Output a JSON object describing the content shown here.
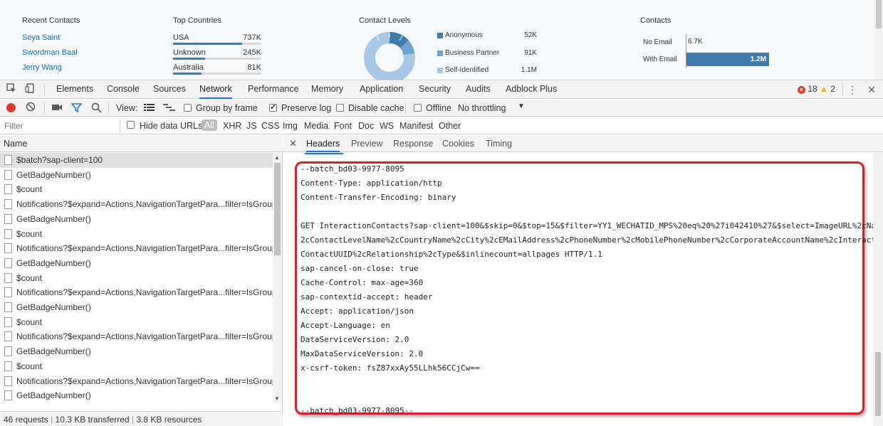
{
  "dashboard": {
    "recent_contacts": {
      "title": "Recent Contacts",
      "items": [
        "Seya Saint",
        "Swordman Baal",
        "Jerry Wang"
      ]
    },
    "top_countries": {
      "title": "Top Countries",
      "items": [
        {
          "name": "USA",
          "value": "737K",
          "fraction": 0.78
        },
        {
          "name": "Unknown",
          "value": "245K",
          "fraction": 0.36
        },
        {
          "name": "Australia",
          "value": "81K",
          "fraction": 0.32
        }
      ]
    },
    "contact_levels": {
      "title": "Contact Levels",
      "items": [
        {
          "name": "Anonymous",
          "value": "52K",
          "color": "#427cac"
        },
        {
          "name": "Business Partner",
          "value": "91K",
          "color": "#6fa3cf"
        },
        {
          "name": "Self-Identified",
          "value": "1.1M",
          "color": "#a8c7e4"
        }
      ]
    },
    "contacts": {
      "title": "Contacts",
      "no_email_label": "No Email",
      "no_email_value": "6.7K",
      "with_email_label": "With Email",
      "with_email_value": "1.2M"
    }
  },
  "devtools": {
    "panel_tabs": [
      "Elements",
      "Console",
      "Sources",
      "Network",
      "Performance",
      "Memory",
      "Application",
      "Security",
      "Audits",
      "Adblock Plus"
    ],
    "active_tab": "Network",
    "error_count": "18",
    "warning_count": "2",
    "toolbar": {
      "view_label": "View:",
      "group_by_frame": "Group by frame",
      "preserve_log": "Preserve log",
      "disable_cache": "Disable cache",
      "offline": "Offline",
      "throttling": "No throttling"
    },
    "filter": {
      "placeholder": "Filter",
      "hide_data_urls": "Hide data URLs",
      "types": [
        "All",
        "XHR",
        "JS",
        "CSS",
        "Img",
        "Media",
        "Font",
        "Doc",
        "WS",
        "Manifest",
        "Other"
      ]
    },
    "name_header": "Name",
    "requests": [
      "$batch?sap-client=100",
      "GetBadgeNumber()",
      "$count",
      "Notifications?$expand=Actions,NavigationTargetPara...filter=IsGroup",
      "GetBadgeNumber()",
      "$count",
      "Notifications?$expand=Actions,NavigationTargetPara...filter=IsGroup",
      "GetBadgeNumber()",
      "$count",
      "Notifications?$expand=Actions,NavigationTargetPara...filter=IsGroup",
      "GetBadgeNumber()",
      "$count",
      "Notifications?$expand=Actions,NavigationTargetPara...filter=IsGroup",
      "GetBadgeNumber()",
      "$count",
      "Notifications?$expand=Actions,NavigationTargetPara...filter=IsGroup",
      "GetBadgeNumber()"
    ],
    "status": {
      "requests": "46 requests",
      "transferred": "10.3 KB transferred",
      "resources": "3.8 KB resources"
    },
    "detail_tabs": [
      "Headers",
      "Preview",
      "Response",
      "Cookies",
      "Timing"
    ],
    "active_detail_tab": "Headers",
    "payload_lines": [
      "--batch_bd03-9977-8095",
      "Content-Type: application/http",
      "Content-Transfer-Encoding: binary",
      "",
      "GET InteractionContacts?sap-client=100&$skip=0&$top=15&$filter=YY1_WECHATID_MPS%20eq%20%27i042410%27&$select=ImageURL%2cNam",
      "2cContactLevelName%2cCountryName%2cCity%2cEMailAddress%2cPhoneNumber%2cMobilePhoneNumber%2cCorporateAccountName%2cInteracti",
      "ContactUUID%2cRelationship%2cType&$inlinecount=allpages HTTP/1.1",
      "sap-cancel-on-close: true",
      "Cache-Control: max-age=360",
      "sap-contextid-accept: header",
      "Accept: application/json",
      "Accept-Language: en",
      "DataServiceVersion: 2.0",
      "MaxDataServiceVersion: 2.0",
      "x-csrf-token: fsZ87xxAy55LLhk56CCjCw==",
      "",
      "",
      "--batch_bd03-9977-8095--"
    ]
  }
}
